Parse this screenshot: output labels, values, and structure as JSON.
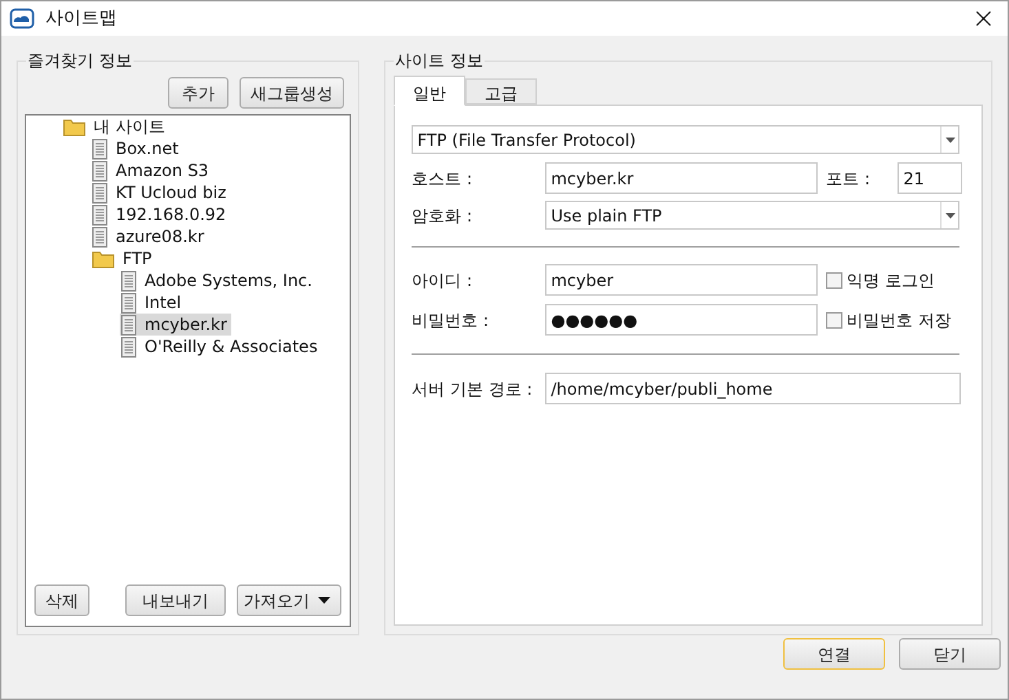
{
  "window": {
    "title": "사이트맵"
  },
  "favorites": {
    "title": "즐겨찾기 정보",
    "top_buttons": [
      "추가",
      "새그룹생성"
    ],
    "tree": [
      {
        "kind": "folder",
        "label": "내 사이트",
        "selected": false,
        "children": [
          {
            "kind": "site",
            "label": "Box.net",
            "selected": false
          },
          {
            "kind": "site",
            "label": "Amazon S3",
            "selected": false
          },
          {
            "kind": "site",
            "label": "KT Ucloud biz",
            "selected": false
          },
          {
            "kind": "site",
            "label": "192.168.0.92",
            "selected": false
          },
          {
            "kind": "site",
            "label": "azure08.kr",
            "selected": false
          },
          {
            "kind": "folder",
            "label": "FTP",
            "selected": false,
            "children": [
              {
                "kind": "site",
                "label": "Adobe Systems, Inc.",
                "selected": false
              },
              {
                "kind": "site",
                "label": "Intel",
                "selected": false
              },
              {
                "kind": "site",
                "label": "mcyber.kr",
                "selected": true
              },
              {
                "kind": "site",
                "label": "O'Reilly & Associates",
                "selected": false
              }
            ]
          }
        ]
      }
    ],
    "delete_button": "삭제",
    "export_button": "내보내기",
    "import_button": "가져오기"
  },
  "site_info": {
    "title": "사이트 정보",
    "tabs": [
      {
        "label": "일반",
        "selected": true
      },
      {
        "label": "고급",
        "selected": false
      }
    ],
    "protocol": "FTP (File Transfer Protocol)",
    "host": {
      "label": "호스트 :",
      "value": "mcyber.kr"
    },
    "port": {
      "label": "포트 :",
      "value": "21"
    },
    "encryption": {
      "label": "암호화 :",
      "value": "Use plain FTP"
    },
    "user": {
      "label": "아이디 :",
      "value": "mcyber"
    },
    "anonymous": {
      "label": "익명 로그인",
      "checked": false
    },
    "password": {
      "label": "비밀번호 :",
      "value": "●●●●●●"
    },
    "save_password": {
      "label": "비밀번호 저장",
      "checked": false
    },
    "path": {
      "label": "서버 기본 경로 :",
      "value": "/home/mcyber/publi_home"
    }
  },
  "buttons": [
    {
      "label": "연결",
      "kind": "default"
    },
    {
      "label": "닫기",
      "kind": "normal"
    }
  ]
}
